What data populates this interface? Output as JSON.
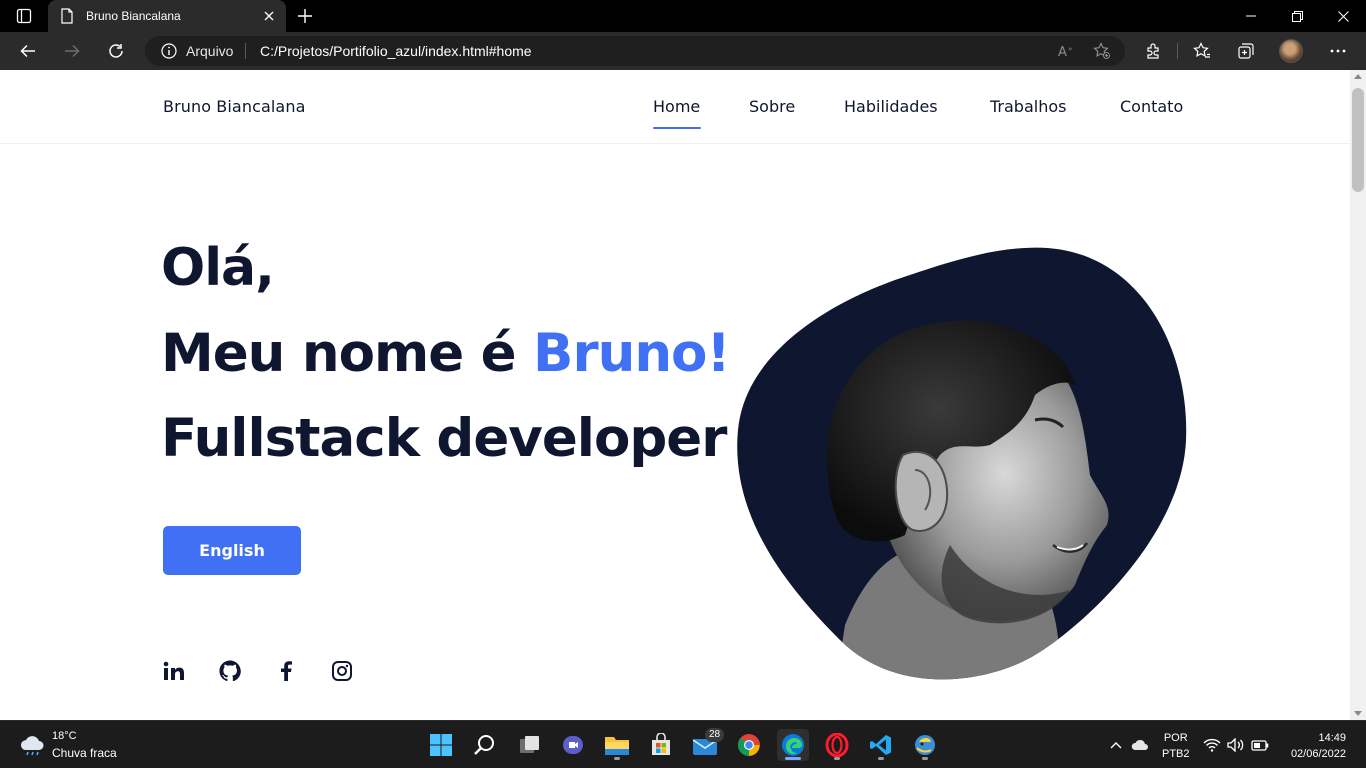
{
  "browser": {
    "tab_title": "Bruno Biancalana",
    "address_label": "Arquivo",
    "url": "C:/Projetos/Portifolio_azul/index.html#home"
  },
  "site": {
    "brand": "Bruno Biancalana",
    "nav": [
      {
        "label": "Home",
        "active": true
      },
      {
        "label": "Sobre"
      },
      {
        "label": "Habilidades"
      },
      {
        "label": "Trabalhos"
      },
      {
        "label": "Contato"
      }
    ],
    "hero": {
      "greeting": "Olá,",
      "name_prefix": "Meu nome é ",
      "name_highlight": "Bruno!",
      "role": "Fullstack developer"
    },
    "cta_label": "English",
    "social_icons": [
      "linkedin-icon",
      "github-icon",
      "facebook-icon",
      "instagram-icon"
    ],
    "colors": {
      "accent": "#4070f4",
      "heading": "#0e1630",
      "blob": "#0e1630"
    }
  },
  "taskbar": {
    "weather": {
      "temp": "18°C",
      "desc": "Chuva fraca"
    },
    "apps": [
      "start-icon",
      "search-icon",
      "task-view-icon",
      "teams-icon",
      "file-explorer-icon",
      "store-icon",
      "mail-icon",
      "chrome-icon",
      "edge-icon",
      "opera-icon",
      "vscode-icon",
      "python-icon"
    ],
    "mail_badge": "28",
    "lang_line1": "POR",
    "lang_line2": "PTB2",
    "time": "14:49",
    "date": "02/06/2022"
  }
}
